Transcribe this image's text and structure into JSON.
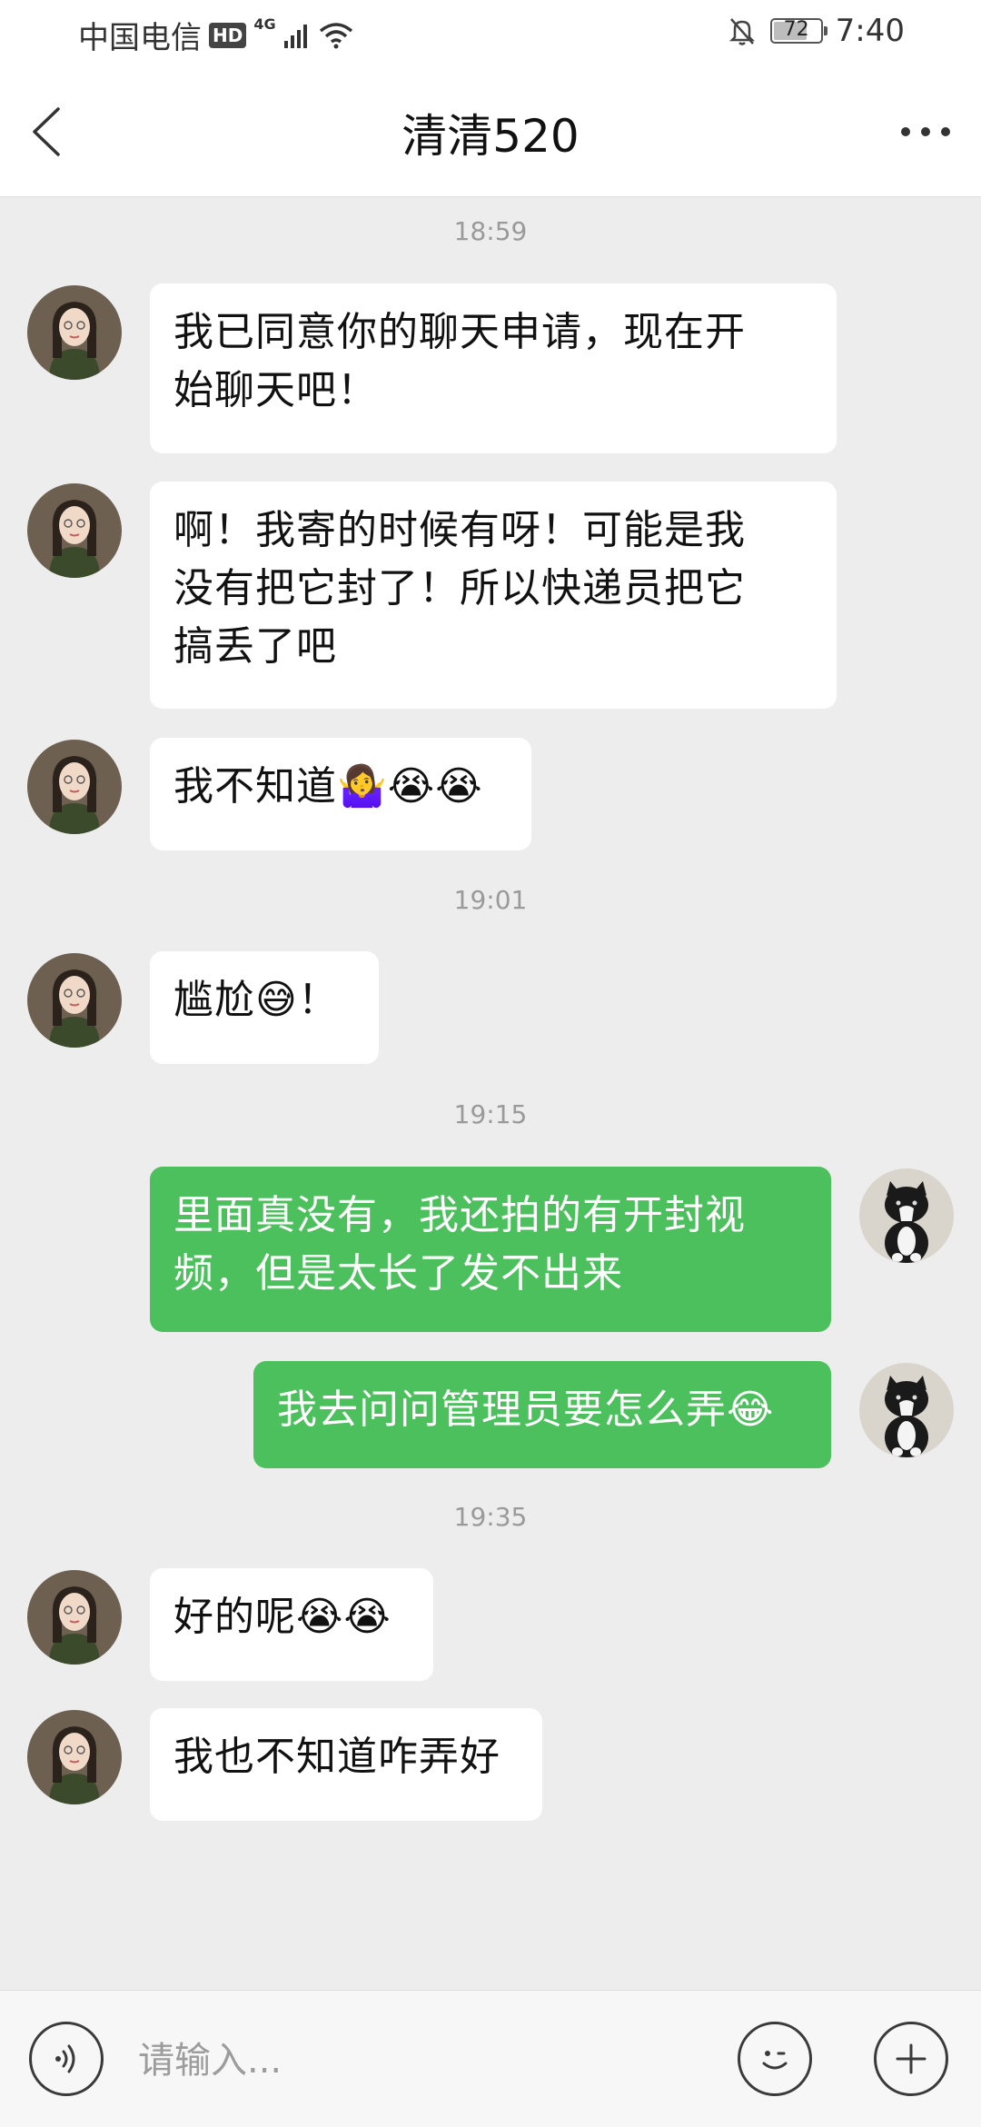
{
  "status": {
    "carrier": "中国电信",
    "hd": "HD",
    "network": "4G",
    "battery": "72",
    "battery_level": 0.72,
    "time": "7:40"
  },
  "header": {
    "title": "清清520"
  },
  "messages": {
    "ts1": "18:59",
    "m1": "我已同意你的聊天申请，现在开\n始聊天吧！",
    "m2": "啊！我寄的时候有呀！可能是我\n没有把它封了！所以快递员把它\n搞丢了吧",
    "m3": "我不知道🤷‍♀️😭😭",
    "ts2": "19:01",
    "m4": "尴尬😅！",
    "ts3": "19:15",
    "m5": "里面真没有，我还拍的有开封视\n频，但是太长了发不出来",
    "m6": "我去问问管理员要怎么弄😂",
    "ts4": "19:35",
    "m7": "好的呢😭😭",
    "m8": "我也不知道咋弄好"
  },
  "input": {
    "placeholder": "请输入..."
  },
  "colors": {
    "outgoing_bubble": "#4cc05c",
    "incoming_bubble": "#ffffff",
    "background": "#ededed"
  },
  "icons": {
    "back": "chevron-left-icon",
    "more": "more-dots-icon",
    "voice": "voice-icon",
    "emoji": "emoji-icon",
    "add": "plus-icon"
  }
}
